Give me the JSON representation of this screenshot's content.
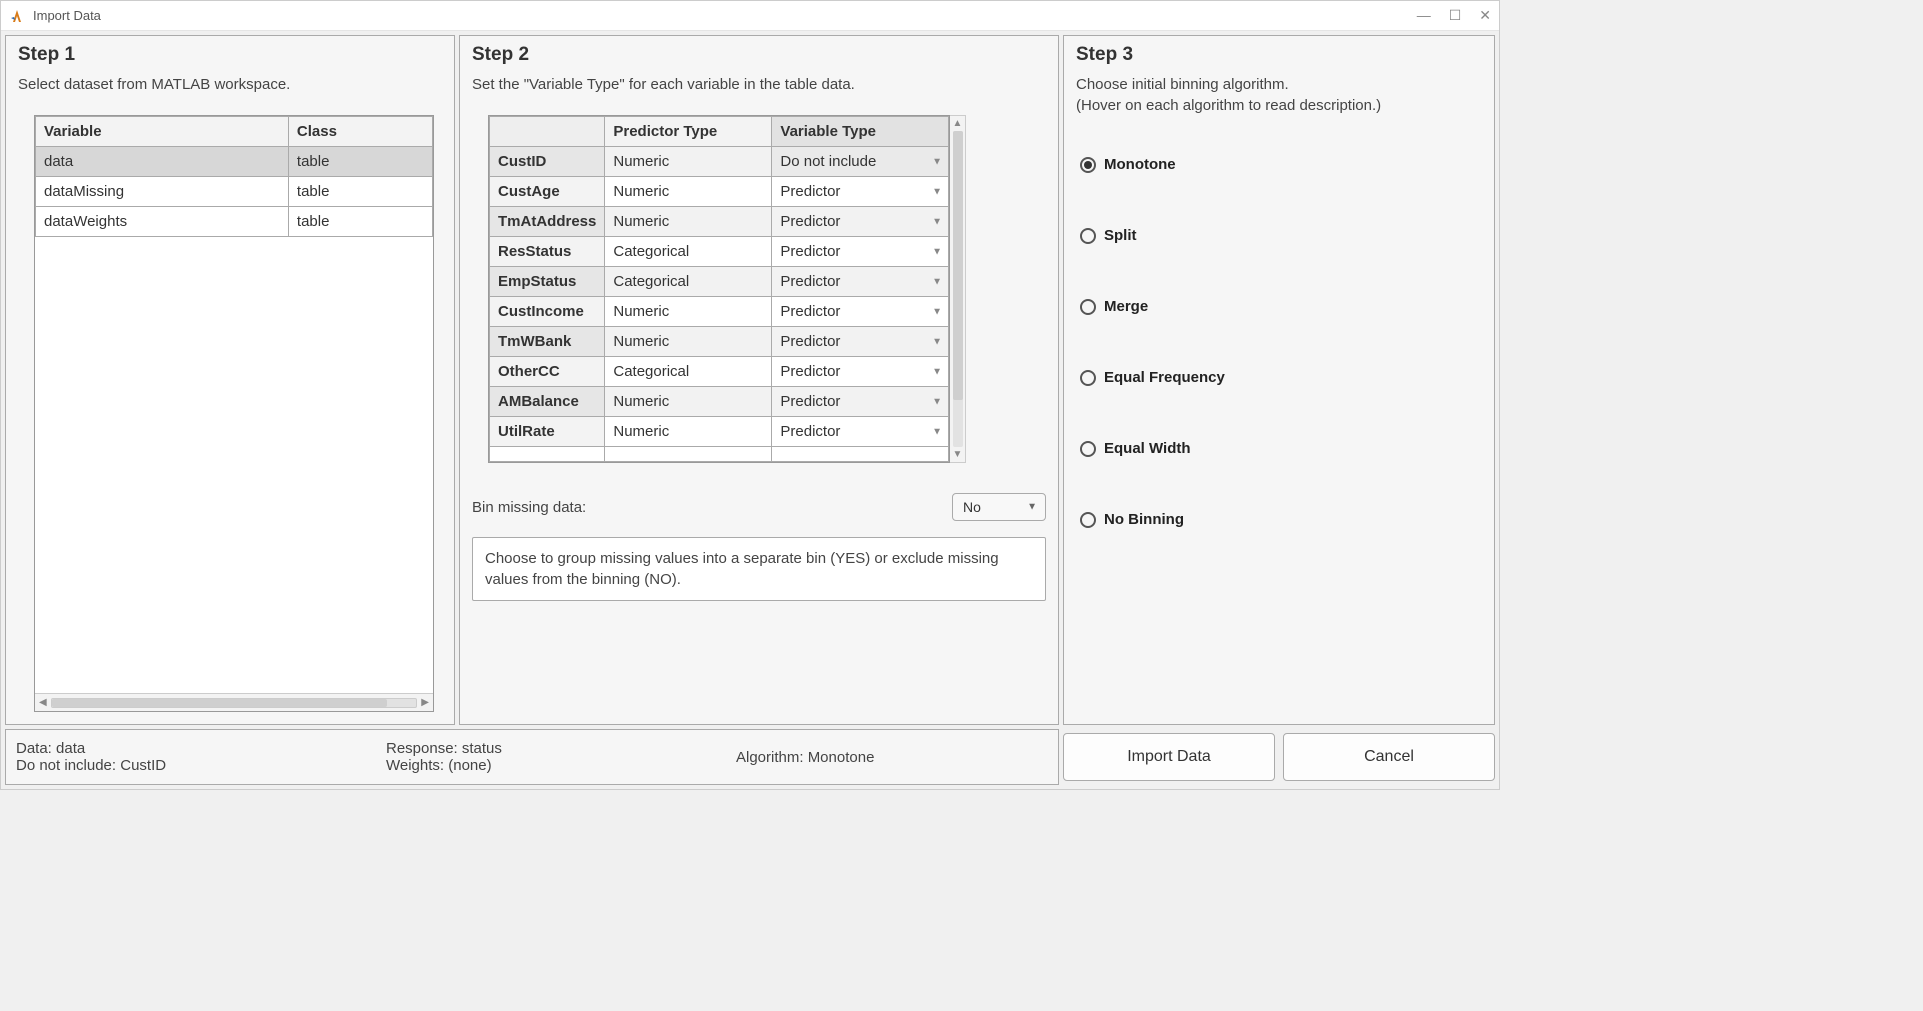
{
  "window": {
    "title": "Import Data"
  },
  "step1": {
    "title": "Step 1",
    "instr": "Select dataset from MATLAB workspace.",
    "headers": {
      "var": "Variable",
      "class": "Class"
    },
    "rows": [
      {
        "var": "data",
        "class": "table",
        "selected": true
      },
      {
        "var": "dataMissing",
        "class": "table",
        "selected": false
      },
      {
        "var": "dataWeights",
        "class": "table",
        "selected": false
      }
    ]
  },
  "step2": {
    "title": "Step 2",
    "instr": "Set the \"Variable Type\" for each variable in the table data.",
    "headers": {
      "pred": "Predictor Type",
      "vt": "Variable Type"
    },
    "rows": [
      {
        "name": "CustID",
        "pred": "Numeric",
        "vt": "Do not include",
        "dim": true
      },
      {
        "name": "CustAge",
        "pred": "Numeric",
        "vt": "Predictor"
      },
      {
        "name": "TmAtAddress",
        "pred": "Numeric",
        "vt": "Predictor"
      },
      {
        "name": "ResStatus",
        "pred": "Categorical",
        "vt": "Predictor"
      },
      {
        "name": "EmpStatus",
        "pred": "Categorical",
        "vt": "Predictor"
      },
      {
        "name": "CustIncome",
        "pred": "Numeric",
        "vt": "Predictor"
      },
      {
        "name": "TmWBank",
        "pred": "Numeric",
        "vt": "Predictor"
      },
      {
        "name": "OtherCC",
        "pred": "Categorical",
        "vt": "Predictor"
      },
      {
        "name": "AMBalance",
        "pred": "Numeric",
        "vt": "Predictor"
      },
      {
        "name": "UtilRate",
        "pred": "Numeric",
        "vt": "Predictor"
      }
    ],
    "bin_missing": {
      "label": "Bin missing data:",
      "value": "No"
    },
    "hint": "Choose to group missing values into a separate bin (YES) or exclude missing values from the binning (NO)."
  },
  "step3": {
    "title": "Step 3",
    "instr1": "Choose initial binning algorithm.",
    "instr2": "(Hover on each algorithm to read description.)",
    "options": [
      {
        "label": "Monotone",
        "checked": true
      },
      {
        "label": "Split",
        "checked": false
      },
      {
        "label": "Merge",
        "checked": false
      },
      {
        "label": "Equal Frequency",
        "checked": false
      },
      {
        "label": "Equal Width",
        "checked": false
      },
      {
        "label": "No Binning",
        "checked": false
      }
    ]
  },
  "status": {
    "data_label": "Data: data",
    "noinclude_label": "Do not include: CustID",
    "response_label": "Response: status",
    "weights_label": "Weights: (none)",
    "algo_label": "Algorithm: Monotone"
  },
  "buttons": {
    "import": "Import Data",
    "cancel": "Cancel"
  }
}
